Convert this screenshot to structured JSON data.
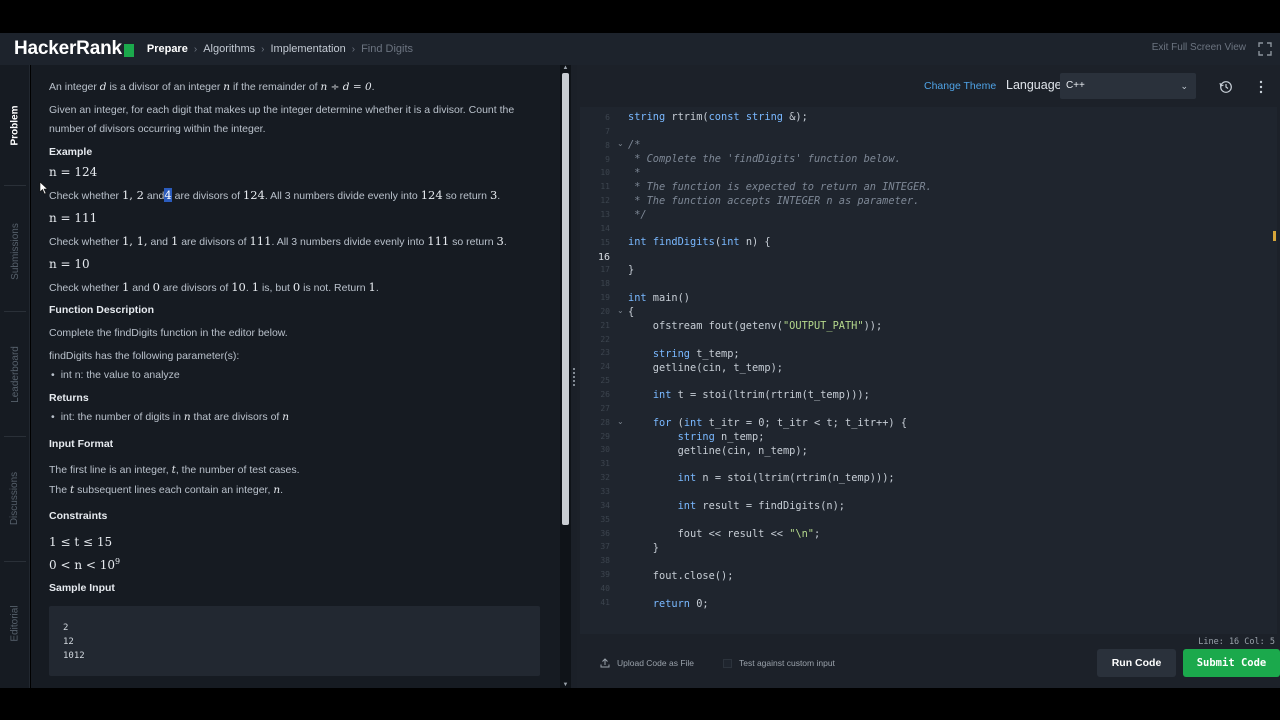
{
  "header": {
    "logo_text": "HackerRank",
    "breadcrumbs": [
      "Prepare",
      "Algorithms",
      "Implementation",
      "Find Digits"
    ],
    "exit_label": "Exit Full Screen View",
    "brand_color": "#1ba94c"
  },
  "side_tabs": [
    "Problem",
    "Submissions",
    "Leaderboard",
    "Discussions",
    "Editorial"
  ],
  "problem": {
    "intro_1": "An integer",
    "intro_1b": "is a divisor of an integer",
    "intro_1c": "if the remainder of",
    "intro_1_math": "n ÷ d = 0",
    "var_d": "d",
    "var_n": "n",
    "intro_2": "Given an integer, for each digit that makes up the integer determine whether it is a divisor. Count the",
    "intro_3": "number of divisors occurring within the integer.",
    "example_heading": "Example",
    "ex1_n": "n = 124",
    "ex1_text_a": "Check whether",
    "ex1_nums": "1, 2",
    "ex1_and": "and",
    "ex1_hl": "4",
    "ex1_text_b": "are divisors of",
    "ex1_val": "124",
    "ex1_text_c": ". All 3 numbers divide evenly into",
    "ex1_val2": "124",
    "ex1_text_d": "so return",
    "ex1_ret": "3",
    "ex2_n": "n = 111",
    "ex2_text_a": "Check whether",
    "ex2_nums": "1, 1,",
    "ex2_and": "and",
    "ex2_n3": "1",
    "ex2_text_b": "are divisors of",
    "ex2_val": "111",
    "ex2_text_c": ". All 3 numbers divide evenly into",
    "ex2_val2": "111",
    "ex2_text_d": "so return",
    "ex2_ret": "3",
    "ex3_n": "n = 10",
    "ex3_text_a": "Check whether",
    "ex3_n1": "1",
    "ex3_and": "and",
    "ex3_n2": "0",
    "ex3_text_b": "are divisors of",
    "ex3_val": "10",
    "ex3_text_c": ".",
    "ex3_n3": "1",
    "ex3_text_d": "is, but",
    "ex3_n4": "0",
    "ex3_text_e": "is not. Return",
    "ex3_ret": "1",
    "func_desc_heading": "Function Description",
    "func_desc_1": "Complete the findDigits function in the editor below.",
    "func_desc_2": "findDigits has the following parameter(s):",
    "param_1": "int n: the value to analyze",
    "returns_heading": "Returns",
    "returns_1": "int: the number of digits in",
    "returns_1b": "that are divisors of",
    "input_heading": "Input Format",
    "input_1a": "The first line is an integer,",
    "input_1_var": "t",
    "input_1b": ", the number of test cases.",
    "input_2a": "The",
    "input_2_var": "t",
    "input_2b": "subsequent lines each contain an integer,",
    "input_2_var2": "n",
    "input_2c": ".",
    "constraints_heading": "Constraints",
    "constraint_1": "1 ≤ t ≤ 15",
    "constraint_2": "0 < n < 10",
    "constraint_2_exp": "9",
    "sample_heading": "Sample Input",
    "sample_lines": [
      "2",
      "12",
      "1012"
    ]
  },
  "editor": {
    "change_theme": "Change Theme",
    "language_label": "Language",
    "language_value": "C++",
    "status": "Line: 16 Col: 5",
    "upload_label": "Upload Code as File",
    "custom_input_label": "Test against custom input",
    "run_label": "Run Code",
    "submit_label": "Submit Code",
    "current_line": "16",
    "line_numbers": [
      "6",
      "7",
      "8",
      "9",
      "10",
      "11",
      "12",
      "13",
      "14",
      "15",
      "16",
      "17",
      "18",
      "19",
      "20",
      "21",
      "22",
      "23",
      "24",
      "25",
      "26",
      "27",
      "28",
      "29",
      "30",
      "31",
      "32",
      "33",
      "34",
      "35",
      "36",
      "37",
      "38",
      "39",
      "40",
      "41"
    ]
  }
}
